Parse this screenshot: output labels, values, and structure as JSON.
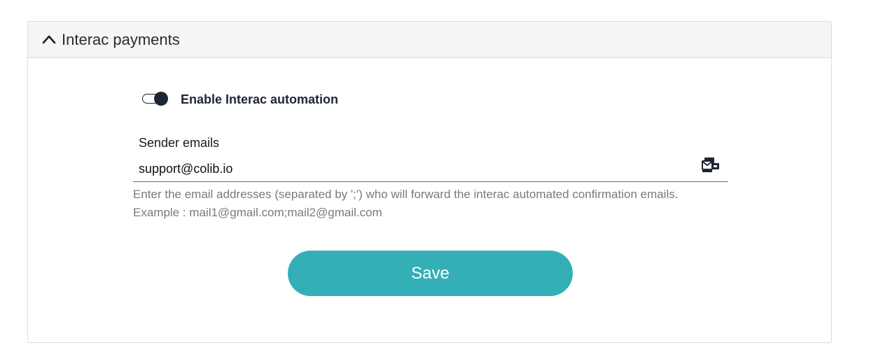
{
  "section": {
    "title": "Interac payments",
    "expanded": true
  },
  "automation": {
    "enabled": true,
    "label": "Enable Interac automation"
  },
  "sender_emails": {
    "label": "Sender emails",
    "value": "support@colib.io",
    "helper_line1": "Enter the email addresses (separated by ';') who will forward the interac automated confirmation emails.",
    "helper_line2": "Example : mail1@gmail.com;mail2@gmail.com",
    "icon": "email-multiple-icon"
  },
  "actions": {
    "save_label": "Save"
  },
  "colors": {
    "accent": "#34afb5",
    "toggle": "#1d2633"
  }
}
